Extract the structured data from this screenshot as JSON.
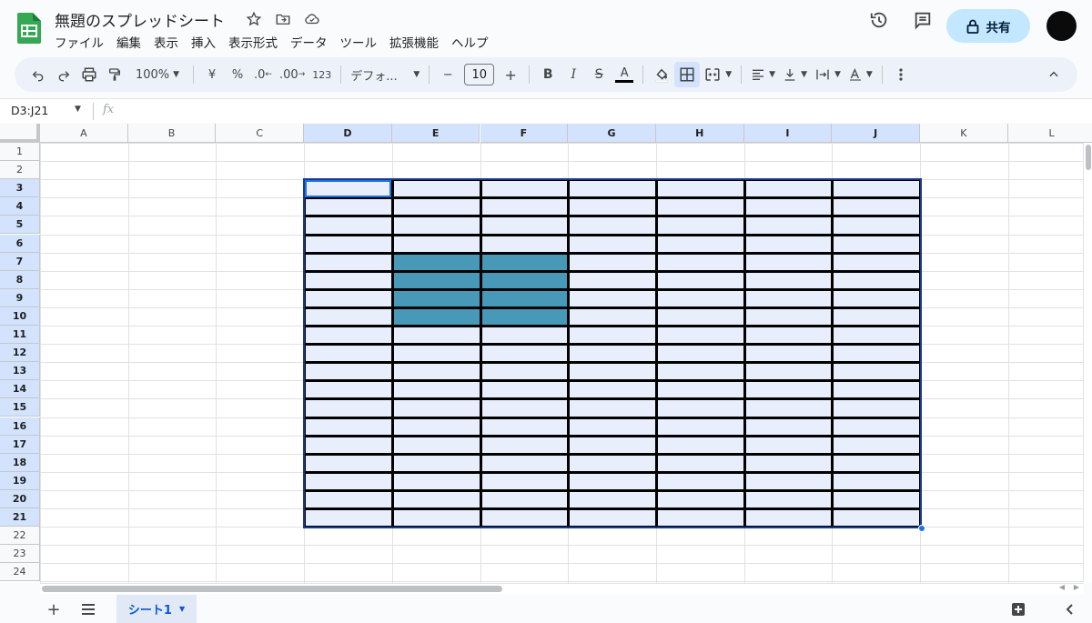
{
  "app": {
    "doc_title": "無題のスプレッドシート",
    "brand_color": "#34a853"
  },
  "menu": [
    "ファイル",
    "編集",
    "表示",
    "挿入",
    "表示形式",
    "データ",
    "ツール",
    "拡張機能",
    "ヘルプ"
  ],
  "header": {
    "share_label": "共有"
  },
  "toolbar": {
    "zoom": "100%",
    "currency": "¥",
    "percent": "%",
    "dec_decrease": ".0",
    "dec_increase": ".00",
    "number_format": "123",
    "font": "デフォ...",
    "minus": "−",
    "font_size": "10",
    "plus": "+",
    "bold": "B",
    "italic": "I",
    "strike": "S",
    "text_color": "A"
  },
  "formula_bar": {
    "name_box": "D3:J21",
    "fx": "fx"
  },
  "grid": {
    "columns": [
      "A",
      "B",
      "C",
      "D",
      "E",
      "F",
      "G",
      "H",
      "I",
      "J",
      "K",
      "L"
    ],
    "selected_columns": [
      "D",
      "E",
      "F",
      "G",
      "H",
      "I",
      "J"
    ],
    "rows": [
      "1",
      "2",
      "3",
      "4",
      "5",
      "6",
      "7",
      "8",
      "9",
      "10",
      "11",
      "12",
      "13",
      "14",
      "15",
      "16",
      "17",
      "18",
      "19",
      "20",
      "21",
      "22",
      "23",
      "24"
    ],
    "selected_rows_from": 3,
    "selected_rows_to": 21,
    "fill_color": "#4799b7",
    "selection_color": "#e8eefc",
    "filled_range": "E7:F10"
  },
  "sheets": {
    "active_tab": "シート1"
  }
}
